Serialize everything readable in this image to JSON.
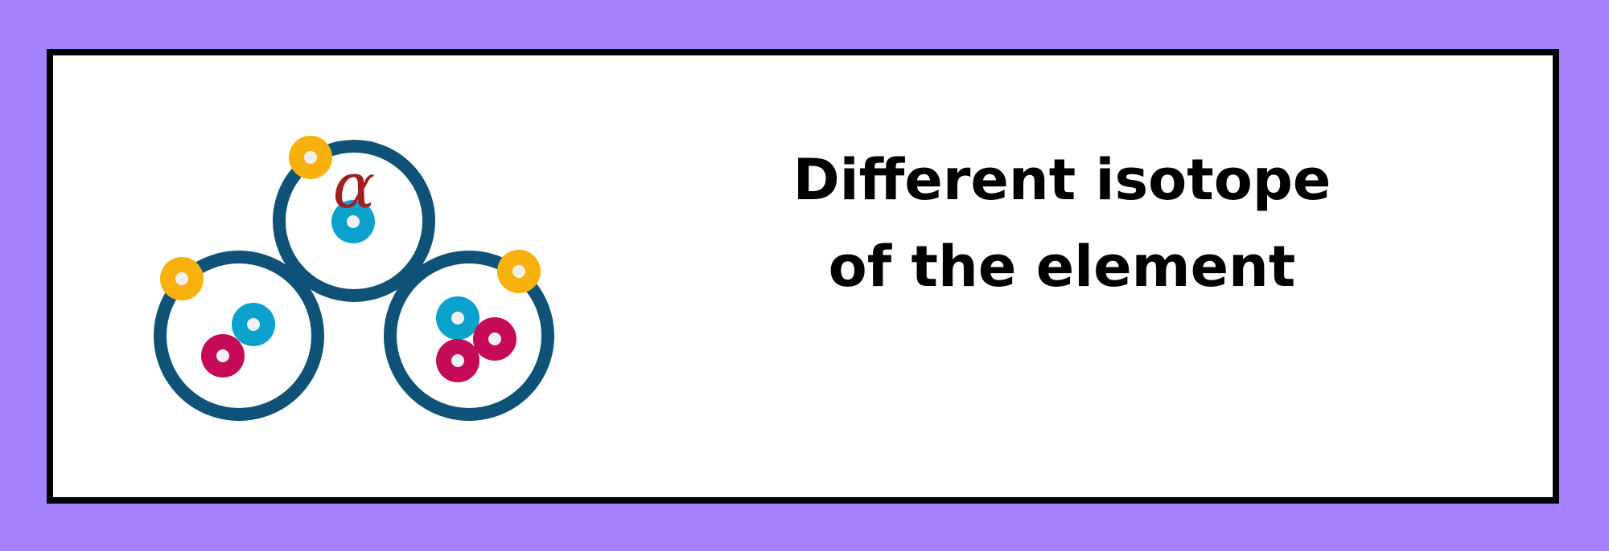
{
  "diagram": {
    "symbol": "α",
    "caption_lines": [
      "Different isotope",
      "of the element"
    ]
  },
  "colors": {
    "frame": "#a681ff",
    "border": "#000000",
    "atom_ring": "#0f5277",
    "electron": "#f9b10d",
    "neutron": "#0aa2cc",
    "proton": "#c60a5a",
    "symbol": "#a11e1e",
    "particle_center": "#f2f0f4"
  }
}
